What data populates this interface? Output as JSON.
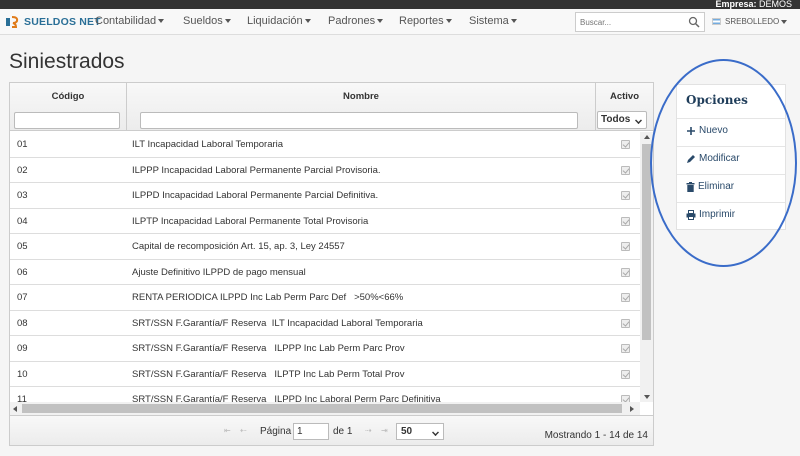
{
  "company": {
    "label": "Empresa:",
    "name": "DEMOS"
  },
  "brand": "SUELDOS NET",
  "nav": [
    {
      "label": "Contabilidad"
    },
    {
      "label": "Sueldos"
    },
    {
      "label": "Liquidación"
    },
    {
      "label": "Padrones"
    },
    {
      "label": "Reportes"
    },
    {
      "label": "Sistema"
    }
  ],
  "search": {
    "placeholder": "Buscar..."
  },
  "user": {
    "name": "SREBOLLEDO"
  },
  "page": {
    "title": "Siniestrados"
  },
  "grid": {
    "columns": [
      "Código",
      "Nombre",
      "Activo"
    ],
    "filter_active_value": "Todos",
    "rows": [
      {
        "code": "01",
        "name": "ILT Incapacidad Laboral Temporaria"
      },
      {
        "code": "02",
        "name": "ILPPP Incapacidad Laboral Permanente Parcial Provisoria."
      },
      {
        "code": "03",
        "name": "ILPPD Incapacidad Laboral Permanente Parcial Definitiva."
      },
      {
        "code": "04",
        "name": "ILPTP Incapacidad Laboral Permanente Total Provisoria"
      },
      {
        "code": "05",
        "name": "Capital de recomposición Art. 15, ap. 3, Ley 24557"
      },
      {
        "code": "06",
        "name": "Ajuste Definitivo ILPPD de pago mensual"
      },
      {
        "code": "07",
        "name": "RENTA PERIODICA ILPPD Inc Lab Perm Parc Def   >50%<66%"
      },
      {
        "code": "08",
        "name": "SRT/SSN F.Garantía/F Reserva  ILT Incapacidad Laboral Temporaria"
      },
      {
        "code": "09",
        "name": "SRT/SSN F.Garantía/F Reserva   ILPPP Inc Lab Perm Parc Prov"
      },
      {
        "code": "10",
        "name": "SRT/SSN F.Garantía/F Reserva   ILPTP Inc Lab Perm Total Prov"
      },
      {
        "code": "11",
        "name": "SRT/SSN F.Garantía/F Reserva   ILPPD Inc Laboral Perm Parc Definitiva"
      }
    ]
  },
  "pager": {
    "page_label": "Página",
    "page_value": "1",
    "of_label": "de 1",
    "page_size": "50",
    "info": "Mostrando 1 - 14 de 14"
  },
  "options": {
    "title": "Opciones",
    "items": [
      {
        "label": "Nuevo",
        "icon": "plus-icon"
      },
      {
        "label": "Modificar",
        "icon": "pencil-icon"
      },
      {
        "label": "Eliminar",
        "icon": "trash-icon"
      },
      {
        "label": "Imprimir",
        "icon": "printer-icon"
      }
    ]
  }
}
